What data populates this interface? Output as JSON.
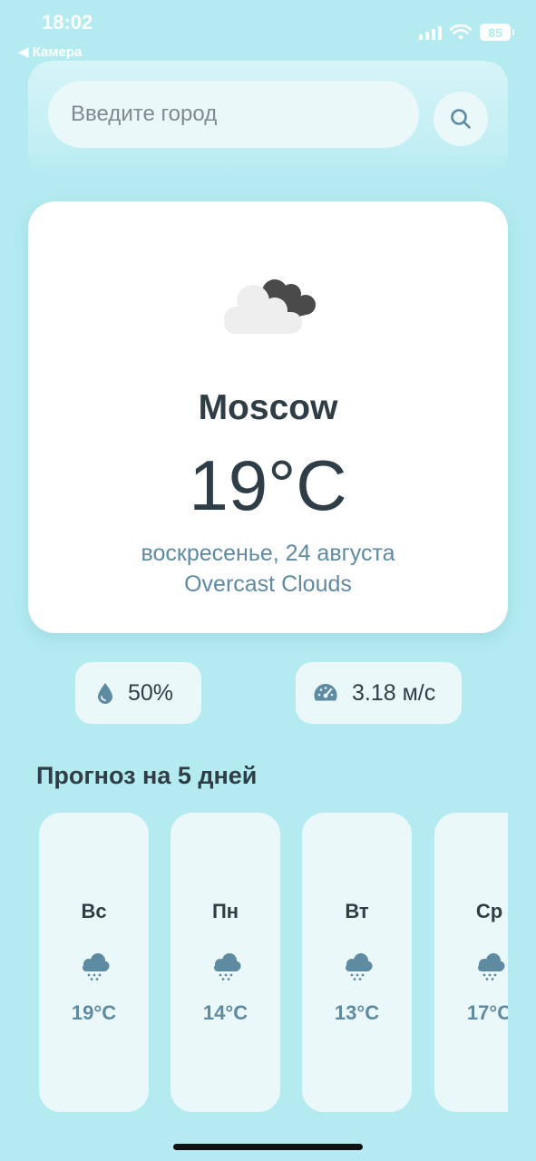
{
  "status_bar": {
    "time": "18:02",
    "back_label": "◀ Камера",
    "battery": "85"
  },
  "search": {
    "placeholder": "Введите город",
    "value": ""
  },
  "current": {
    "icon": "overcast-clouds-icon",
    "city": "Moscow",
    "temperature": "19°C",
    "date": "воскресенье, 24 августа",
    "description": "Overcast Clouds"
  },
  "stats": {
    "humidity": "50%",
    "wind": "3.18 м/с"
  },
  "forecast": {
    "title": "Прогноз на 5 дней",
    "days": [
      {
        "day": "Вс",
        "temp": "19°C",
        "icon": "rain-cloud-icon"
      },
      {
        "day": "Пн",
        "temp": "14°C",
        "icon": "rain-cloud-icon"
      },
      {
        "day": "Вт",
        "temp": "13°C",
        "icon": "rain-cloud-icon"
      },
      {
        "day": "Ср",
        "temp": "17°C",
        "icon": "rain-cloud-icon"
      }
    ]
  },
  "colors": {
    "background": "#b4ebf1",
    "card": "#ffffff",
    "pill": "#eaf8fa",
    "text_dark": "#2f3e46",
    "text_accent": "#5e8aa2"
  }
}
